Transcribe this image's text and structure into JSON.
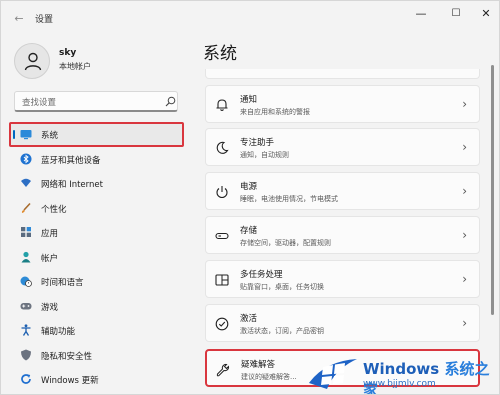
{
  "window": {
    "title": "设置",
    "back_glyph": "←",
    "controls": {
      "minimize": "—",
      "maximize": "☐",
      "close": "✕"
    }
  },
  "profile": {
    "name": "sky",
    "account_type": "本地帐户"
  },
  "search": {
    "placeholder": "查找设置"
  },
  "sidebar": {
    "items": [
      {
        "label": "系统",
        "icon": "monitor-icon",
        "active": true
      },
      {
        "label": "蓝牙和其他设备",
        "icon": "bluetooth-icon"
      },
      {
        "label": "网络和 Internet",
        "icon": "wifi-icon"
      },
      {
        "label": "个性化",
        "icon": "brush-icon"
      },
      {
        "label": "应用",
        "icon": "apps-icon"
      },
      {
        "label": "帐户",
        "icon": "person-icon"
      },
      {
        "label": "时间和语言",
        "icon": "globe-clock-icon"
      },
      {
        "label": "游戏",
        "icon": "gamepad-icon"
      },
      {
        "label": "辅助功能",
        "icon": "accessibility-icon"
      },
      {
        "label": "隐私和安全性",
        "icon": "shield-icon"
      },
      {
        "label": "Windows 更新",
        "icon": "update-icon"
      }
    ]
  },
  "main": {
    "title": "系统",
    "cards": [
      {
        "title": "通知",
        "subtitle": "来自应用和系统的警报",
        "icon": "bell-icon"
      },
      {
        "title": "专注助手",
        "subtitle": "通知，自动规则",
        "icon": "moon-icon"
      },
      {
        "title": "电源",
        "subtitle": "睡眠，电池使用情况，节电模式",
        "icon": "power-icon"
      },
      {
        "title": "存储",
        "subtitle": "存储空间，驱动器，配置规则",
        "icon": "storage-icon"
      },
      {
        "title": "多任务处理",
        "subtitle": "贴靠窗口，桌面，任务切换",
        "icon": "multitask-icon"
      },
      {
        "title": "激活",
        "subtitle": "激活状态，订阅，产品密钥",
        "icon": "check-circle-icon"
      },
      {
        "title": "疑难解答",
        "subtitle": "建议的疑难解答...",
        "icon": "wrench-icon",
        "highlighted": true
      }
    ]
  },
  "watermark": {
    "brand": "Windows",
    "suffix": "系统之家",
    "url": "www.bjjmlv.com"
  },
  "colors": {
    "accent": "#0067c0",
    "highlight_box": "#d9363e",
    "background": "#f3f3f3",
    "card": "#fbfbfb"
  }
}
